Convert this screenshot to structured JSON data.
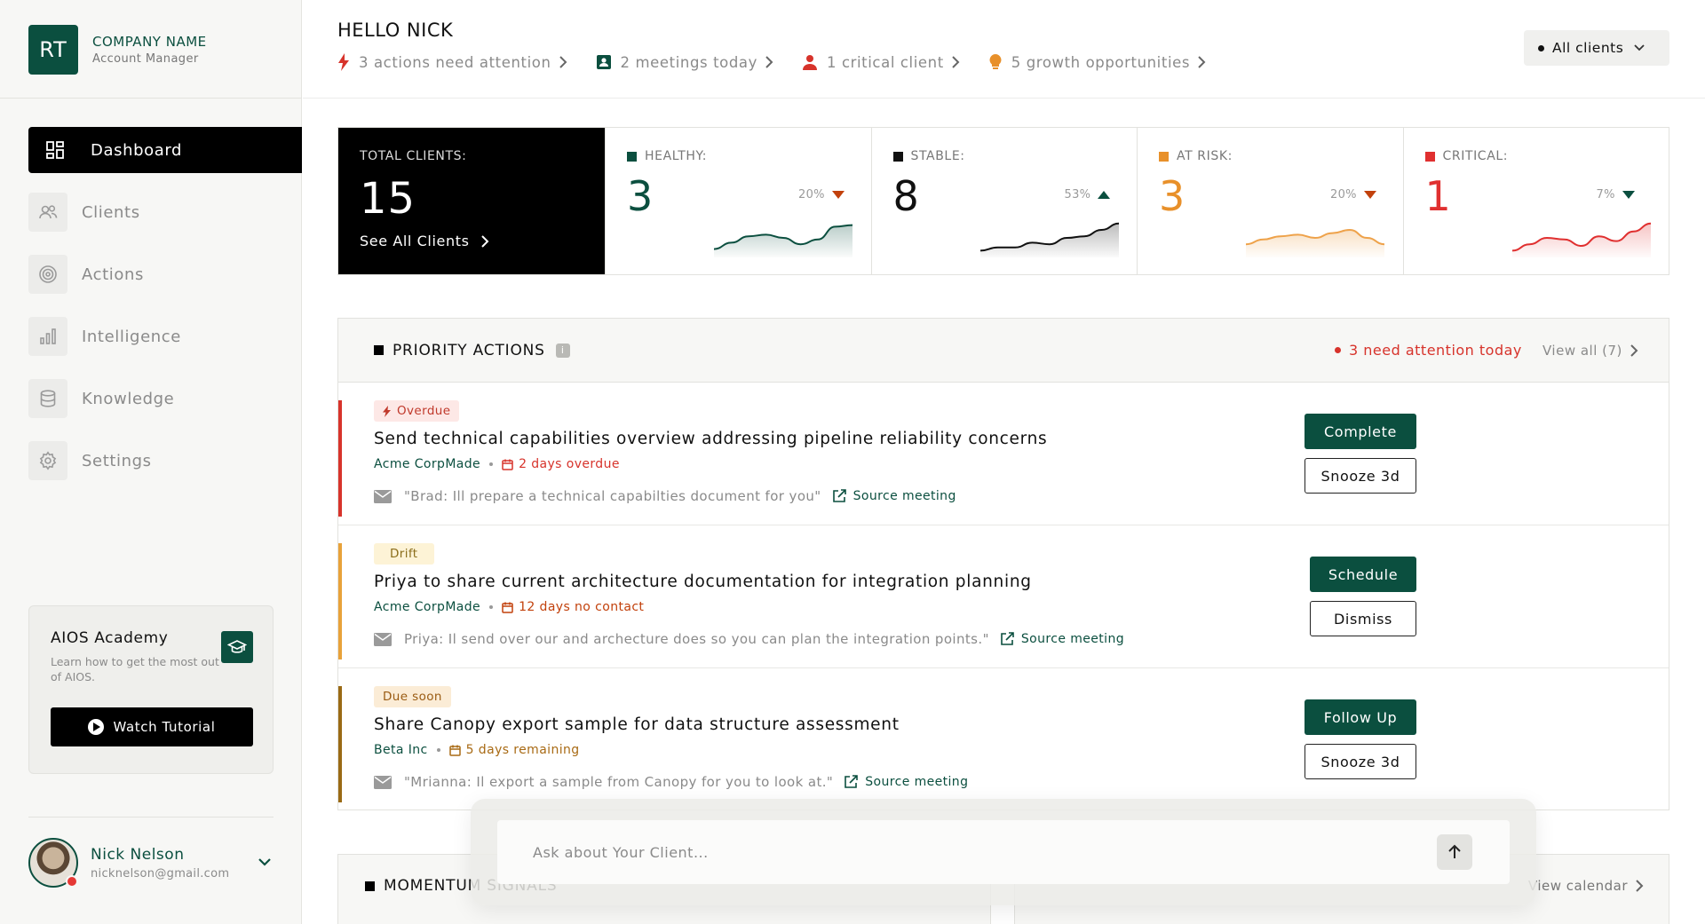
{
  "brand": {
    "initials": "RT",
    "name": "COMPANY NAME",
    "role": "Account Manager"
  },
  "nav": [
    {
      "label": "Dashboard",
      "icon": "grid-icon",
      "active": true
    },
    {
      "label": "Clients",
      "icon": "users-icon"
    },
    {
      "label": "Actions",
      "icon": "target-icon"
    },
    {
      "label": "Intelligence",
      "icon": "bar-chart-icon"
    },
    {
      "label": "Knowledge",
      "icon": "database-icon"
    },
    {
      "label": "Settings",
      "icon": "gear-icon"
    }
  ],
  "academy": {
    "title": "AIOS Academy",
    "description": "Learn how to get the most out of AIOS.",
    "button": "Watch Tutorial"
  },
  "user": {
    "name": "Nick Nelson",
    "email": "nicknelson@gmail.com"
  },
  "header": {
    "greeting": "HELLO NICK",
    "summary": [
      {
        "text": "3 actions need attention",
        "icon": "bolt-icon",
        "color": "#d7332b"
      },
      {
        "text": "2 meetings today",
        "icon": "calendar-person-icon",
        "color": "#0b4f3f"
      },
      {
        "text": "1 critical client",
        "icon": "person-icon",
        "color": "#d7332b"
      },
      {
        "text": "5 growth opportunities",
        "icon": "lightbulb-icon",
        "color": "#e8902a"
      }
    ],
    "client_filter": "All clients"
  },
  "stats": {
    "total": {
      "label": "TOTAL CLIENTS:",
      "value": "15",
      "link": "See All Clients"
    },
    "cards": [
      {
        "label": "HEALTHY:",
        "value": "3",
        "trend": "20%",
        "direction": "down",
        "color": "#0b4f3f",
        "value_color": "#0b4f3f",
        "arrow_color": "#c2410c",
        "spark": [
          0.15,
          0.35,
          0.55,
          0.6,
          0.5,
          0.3,
          0.45,
          0.85,
          0.9
        ]
      },
      {
        "label": "STABLE:",
        "value": "8",
        "trend": "53%",
        "direction": "up",
        "color": "#111111",
        "value_color": "#111111",
        "arrow_color": "#0b4f3f",
        "spark": [
          0.1,
          0.2,
          0.2,
          0.35,
          0.3,
          0.5,
          0.55,
          0.75,
          0.95
        ]
      },
      {
        "label": "AT RISK:",
        "value": "3",
        "trend": "20%",
        "direction": "down",
        "color": "#e8902a",
        "value_color": "#e8902a",
        "arrow_color": "#c2410c",
        "spark": [
          0.3,
          0.45,
          0.55,
          0.6,
          0.5,
          0.65,
          0.75,
          0.5,
          0.3
        ]
      },
      {
        "label": "CRITICAL:",
        "value": "1",
        "trend": "7%",
        "direction": "down",
        "color": "#e03030",
        "value_color": "#e03030",
        "arrow_color": "#0b4f3f",
        "spark": [
          0.1,
          0.3,
          0.5,
          0.45,
          0.25,
          0.55,
          0.4,
          0.7,
          0.95
        ]
      }
    ]
  },
  "priority": {
    "title": "PRIORITY ACTIONS",
    "attention": "3 need attention today",
    "view_all": "View all (7)",
    "items": [
      {
        "tag": "Overdue",
        "tag_bg": "#fde8e6",
        "tag_fg": "#c0392b",
        "stripe": "#d7332b",
        "title": "Send technical capabilities overview addressing pipeline reliability concerns",
        "company": "Acme CorpMade",
        "due": "2 days overdue",
        "due_color": "#d7332b",
        "quote": "\"Brad: Ill prepare a technical capabilties document for you\"",
        "source": "Source meeting",
        "primary": "Complete",
        "secondary": "Snooze 3d"
      },
      {
        "tag": "Drift",
        "tag_bg": "#fdf3d6",
        "tag_fg": "#8a6d1a",
        "stripe": "#e8a23a",
        "title": "Priya to share current architecture documentation for integration planning",
        "company": "Acme CorpMade",
        "due": "12 days no contact",
        "due_color": "#c2410c",
        "quote": "Priya: Il send over our and archecture does so you can plan the integration points.\"",
        "source": "Source meeting",
        "primary": "Schedule",
        "secondary": "Dismiss"
      },
      {
        "tag": "Due soon",
        "tag_bg": "#fbecd6",
        "tag_fg": "#9a5b12",
        "stripe": "#9a6a14",
        "title": "Share Canopy export sample for data structure assessment",
        "company": "Beta Inc",
        "due": "5 days remaining",
        "due_color": "#a86a14",
        "quote": "\"Mrianna: Il export a sample from Canopy for you to look at.\"",
        "source": "Source meeting",
        "primary": "Follow Up",
        "secondary": "Snooze 3d"
      }
    ]
  },
  "momentum": {
    "title": "MOMENTUM SIGNALS"
  },
  "meetings": {
    "calendar_link": "View calendar"
  },
  "ask": {
    "placeholder": "Ask about Your Client..."
  }
}
